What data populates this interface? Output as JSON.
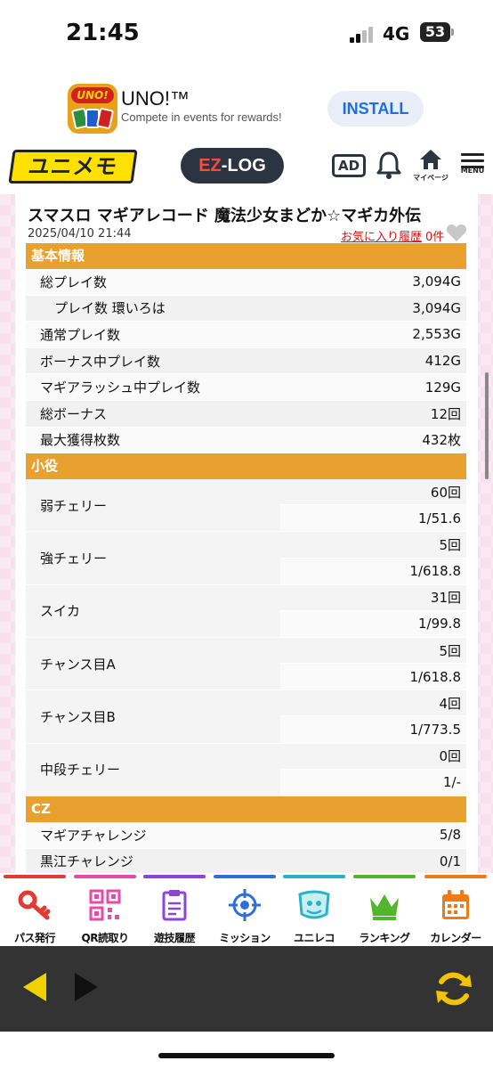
{
  "status_bar": {
    "time": "21:45",
    "network": "4G",
    "battery": "53"
  },
  "ad": {
    "app_name": "UNO!™",
    "subtitle": "Compete in events for rewards!",
    "install_label": "INSTALL",
    "icon_logo": "UNO!"
  },
  "header": {
    "logo": "ユニメモ",
    "ezlog_prefix": "EZ",
    "ezlog_suffix": "-LOG",
    "ad_label": "AD",
    "mypage_label": "マイページ",
    "menu_label": "MENU"
  },
  "article": {
    "title": "スマスロ マギアレコード 魔法少女まどか☆マギカ外伝",
    "date": "2025/04/10 21:44",
    "fav_link": "お気に入り履歴",
    "fav_count": "0件"
  },
  "basic": {
    "header": "基本情報",
    "rows": [
      {
        "label": "総プレイ数",
        "value": "3,094G"
      },
      {
        "label": "プレイ数 環いろは",
        "value": "3,094G"
      },
      {
        "label": "通常プレイ数",
        "value": "2,553G"
      },
      {
        "label": "ボーナス中プレイ数",
        "value": "412G"
      },
      {
        "label": "マギアラッシュ中プレイ数",
        "value": "129G"
      },
      {
        "label": "総ボーナス",
        "value": "12回"
      },
      {
        "label": "最大獲得枚数",
        "value": "432枚"
      }
    ]
  },
  "koyaku": {
    "header": "小役",
    "rows": [
      {
        "label": "弱チェリー",
        "count": "60回",
        "prob": "1/51.6"
      },
      {
        "label": "強チェリー",
        "count": "5回",
        "prob": "1/618.8"
      },
      {
        "label": "スイカ",
        "count": "31回",
        "prob": "1/99.8"
      },
      {
        "label": "チャンス目A",
        "count": "5回",
        "prob": "1/618.8"
      },
      {
        "label": "チャンス目B",
        "count": "4回",
        "prob": "1/773.5"
      },
      {
        "label": "中段チェリー",
        "count": "0回",
        "prob": "1/-"
      }
    ]
  },
  "cz": {
    "header": "CZ",
    "rows": [
      {
        "label": "マギアチャレンジ",
        "value": "5/8"
      },
      {
        "label": "黒江チャレンジ",
        "value": "0/1"
      }
    ]
  },
  "tabs": [
    {
      "label": "パス発行",
      "icon": "key-icon",
      "color": "#e53935"
    },
    {
      "label": "QR読取り",
      "icon": "qr-code-icon",
      "color": "#e84aa8"
    },
    {
      "label": "遊技履歴",
      "icon": "clipboard-icon",
      "color": "#8e44d8"
    },
    {
      "label": "ミッション",
      "icon": "target-icon",
      "color": "#2f6fd8"
    },
    {
      "label": "ユニレコ",
      "icon": "unireco-icon",
      "color": "#2ab3c6"
    },
    {
      "label": "ランキング",
      "icon": "crown-icon",
      "color": "#52b62a"
    },
    {
      "label": "カレンダー",
      "icon": "calendar-icon",
      "color": "#f07a18"
    }
  ]
}
